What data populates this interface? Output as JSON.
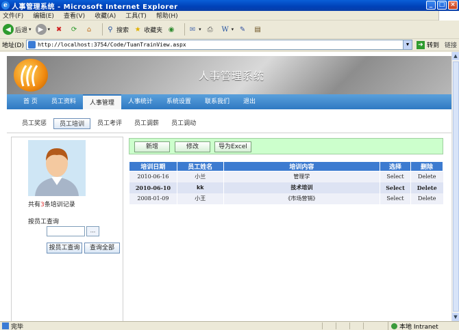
{
  "window": {
    "title": "人事管理系统 - Microsoft Internet Explorer",
    "menu": [
      "文件(F)",
      "编辑(E)",
      "查看(V)",
      "收藏(A)",
      "工具(T)",
      "帮助(H)"
    ]
  },
  "toolbar": {
    "back": "后退",
    "search": "搜索",
    "favorites": "收藏夹"
  },
  "address": {
    "label": "地址(D)",
    "url": "http://localhost:3754/Code/TuanTrainView.aspx",
    "go": "转到",
    "links": "链接"
  },
  "site": {
    "title": "人事管理系统",
    "nav": [
      "首 页",
      "员工资料",
      "人事管理",
      "人事统计",
      "系统设置",
      "联系我们",
      "退出"
    ],
    "active_nav": "人事管理",
    "subnav": [
      "员工奖惩",
      "员工培训",
      "员工考评",
      "员工调薪",
      "员工调动"
    ],
    "active_subnav": "员工培训"
  },
  "left": {
    "count_prefix": "共有",
    "count_num": "3",
    "count_suffix": "条培训记录",
    "query_label": "按员工查询",
    "browse_label": "...",
    "query_button": "按员工查询",
    "all_button": "查询全部"
  },
  "actions": {
    "add": "新增",
    "edit": "修改",
    "export": "导为Excel"
  },
  "grid": {
    "headers": [
      "培训日期",
      "员工姓名",
      "培训内容",
      "选择",
      "删除"
    ],
    "rows": [
      {
        "date": "2010-06-16",
        "name": "小兰",
        "content": "管理学",
        "select": "Select",
        "delete": "Delete"
      },
      {
        "date": "2010-06-10",
        "name": "kk",
        "content": "技术培训",
        "select": "Select",
        "delete": "Delete"
      },
      {
        "date": "2008-01-09",
        "name": "小王",
        "content": "《市场营销》",
        "select": "Select",
        "delete": "Delete"
      }
    ]
  },
  "status": {
    "done": "完毕",
    "zone": "本地 Intranet"
  },
  "colors": {
    "nav_blue": "#2f79c2",
    "header_blue": "#3c7bd0",
    "action_green": "#ccffcc",
    "count_red": "#e03030"
  }
}
